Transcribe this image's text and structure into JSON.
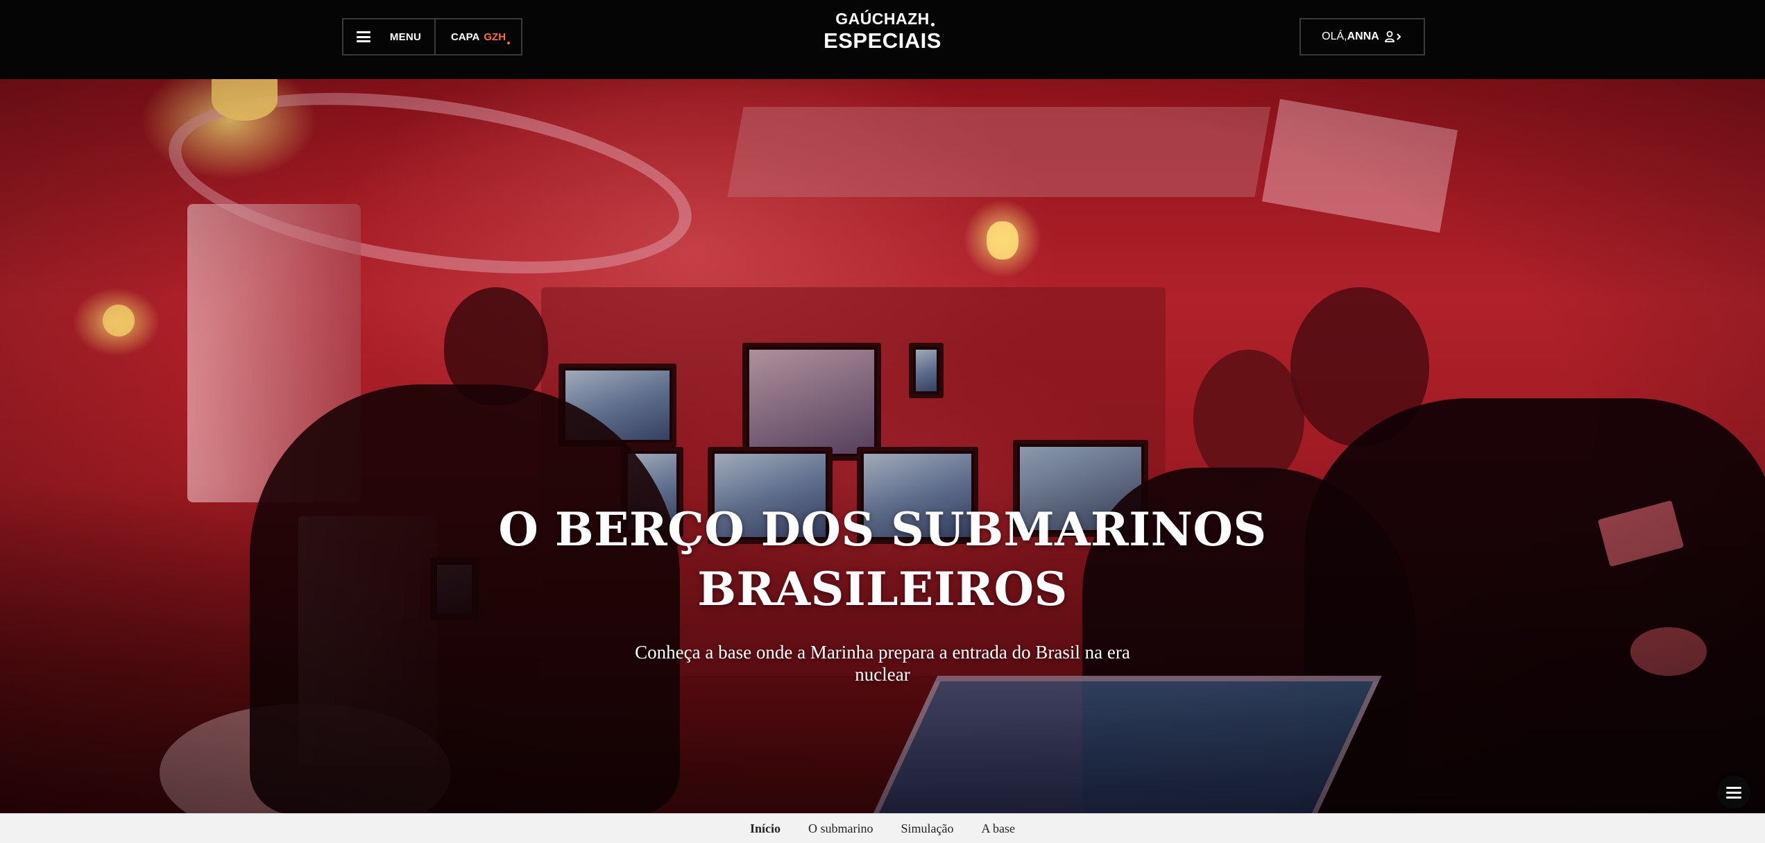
{
  "header": {
    "menu_label": "MENU",
    "capa_prefix": "CAPA",
    "capa_brand": "GZH",
    "logo_brand": "GAÚCHAZH",
    "logo_section": "ESPECIAIS",
    "user_greeting": "OLÁ,",
    "user_name": "ANNA"
  },
  "hero": {
    "title": "O BERÇO DOS SUBMARINOS BRASILEIROS",
    "subtitle": "Conheça a base onde a Marinha prepara a entrada do Brasil na era nuclear",
    "image_alt": "Oficiais na sala de controle de um submarino sob luz vermelha"
  },
  "bottom_nav": {
    "items": [
      {
        "label": "Início",
        "active": true
      },
      {
        "label": "O submarino",
        "active": false
      },
      {
        "label": "Simulação",
        "active": false
      },
      {
        "label": "A base",
        "active": false
      }
    ]
  },
  "colors": {
    "header_bg": "#050505",
    "accent_gzh": "#ff6a3a",
    "hero_tint": "#b0212a",
    "bottom_nav_bg": "#f2f2f2"
  },
  "icons": {
    "menu": "hamburger-icon",
    "user": "user-icon",
    "chevron": "chevron-right-icon",
    "floating_menu": "hamburger-icon"
  }
}
